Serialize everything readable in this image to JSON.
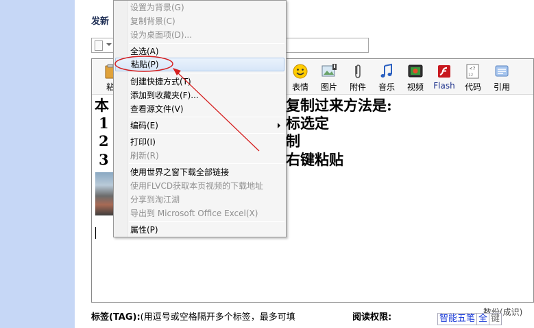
{
  "page": {
    "title_prefix": "发新",
    "tag_label_bold": "标签(TAG):",
    "tag_hint": "(用逗号或空格隔开多个标签，最多可填",
    "read_permission_label": "阅读权限:",
    "right_clip": "数份(成识)"
  },
  "toolbar": {
    "buttons": [
      {
        "name": "paste",
        "label": "粘"
      },
      {
        "name": "emoticon",
        "label": "表情"
      },
      {
        "name": "image",
        "label": "图片"
      },
      {
        "name": "attachment",
        "label": "附件"
      },
      {
        "name": "music",
        "label": "音乐"
      },
      {
        "name": "video",
        "label": "视频"
      },
      {
        "name": "flash",
        "label": "Flash"
      },
      {
        "name": "code",
        "label": "代码"
      },
      {
        "name": "quote",
        "label": "引用"
      }
    ]
  },
  "editor": {
    "lines": [
      {
        "left": "本",
        "right": "复制过来方法是:"
      },
      {
        "left": "1",
        "right": "标选定"
      },
      {
        "left": "2",
        "right": "制"
      },
      {
        "left": "3",
        "right": "右键粘贴"
      }
    ]
  },
  "context_menu": {
    "items": [
      {
        "label": "设置为背景(G)",
        "disabled": true
      },
      {
        "label": "复制背景(C)",
        "disabled": true
      },
      {
        "label": "设为桌面项(D)...",
        "disabled": true
      },
      {
        "label": "全选(A)",
        "disabled": false
      },
      {
        "label": "粘贴(P)",
        "disabled": false,
        "highlighted": true
      },
      {
        "label": "创建快捷方式(T)",
        "disabled": false
      },
      {
        "label": "添加到收藏夹(F)...",
        "disabled": false
      },
      {
        "label": "查看源文件(V)",
        "disabled": false
      },
      {
        "label": "编码(E)",
        "disabled": false,
        "submenu": true
      },
      {
        "label": "打印(I)",
        "disabled": false
      },
      {
        "label": "刷新(R)",
        "disabled": true
      },
      {
        "label": "使用世界之窗下载全部链接",
        "disabled": false
      },
      {
        "label": "使用FLVCD获取本页视频的下载地址",
        "disabled": true
      },
      {
        "label": "分享到淘江湖",
        "disabled": true
      },
      {
        "label": "导出到 Microsoft Office Excel(X)",
        "disabled": true
      },
      {
        "label": "属性(P)",
        "disabled": false
      }
    ]
  },
  "ime": {
    "mode": "智能五笔",
    "width": "全",
    "extra": "键"
  },
  "colors": {
    "sidebar": "#c6d7f6",
    "annotation_red": "#d62020",
    "menu_highlight_border": "#a9c6ea"
  }
}
